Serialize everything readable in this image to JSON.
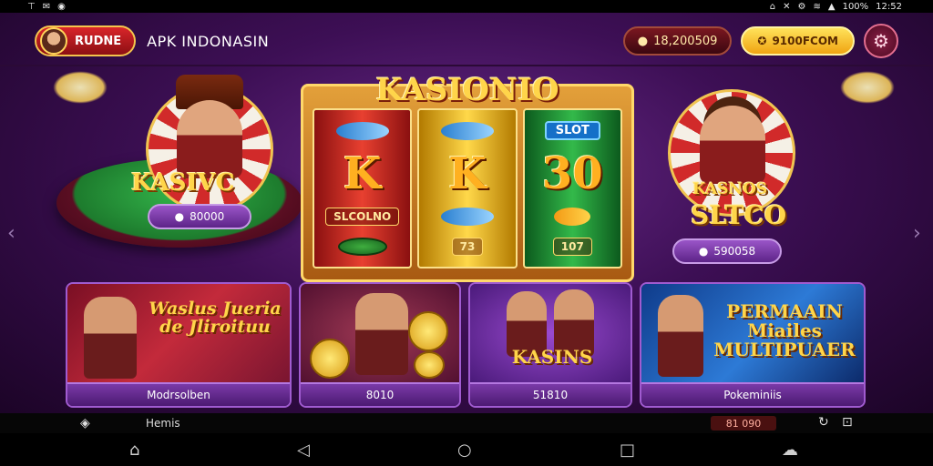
{
  "status_bar": {
    "left_icons": [
      "⊤",
      "✉",
      "◉"
    ],
    "right_icons": [
      "⌂",
      "✕",
      "⚙",
      "≋",
      "▲"
    ],
    "battery": "100%",
    "time": "12:52"
  },
  "header": {
    "brand": "RUDNE",
    "title": "APK INDONASIN",
    "balance_icon": "coin-icon",
    "balance": "18,200509",
    "deposit_label": "9100FCOM",
    "settings_icon": "gear-icon"
  },
  "hero": {
    "slot_title": "KASIONIO",
    "reels": [
      {
        "top": "fish",
        "main": "K",
        "bottom": "SLCOLNO",
        "foot": "chip"
      },
      {
        "top": "fish",
        "main": "K",
        "bottom": "fish",
        "foot": "73"
      },
      {
        "top": "SLOT",
        "main": "30",
        "bottom": "leaf",
        "foot": "107"
      }
    ],
    "left_logo": "KASIVC",
    "left_amount": "80000",
    "right_logo_1": "KASNOS",
    "right_logo_2": "SLTCO",
    "right_amount": "590058"
  },
  "cards": [
    {
      "art_text": "Waslus Jueria de Jliroituu",
      "label": "Modrsolben"
    },
    {
      "art_text": "",
      "label": "8010"
    },
    {
      "art_text": "KASINS",
      "label": "51810"
    },
    {
      "art_text": "PERMAAIN Miailes MULTIPUAER",
      "label": "Pokeminiis"
    }
  ],
  "bottom_bar": {
    "home_label": "Hemis",
    "badge": "81 090"
  },
  "nav": {
    "home": "⌂",
    "back": "◁",
    "circle": "○",
    "square": "□",
    "extra": "☁"
  },
  "colors": {
    "background": "#3d0f55",
    "accent_gold": "#ffd54a",
    "brand_red": "#d9252a",
    "card_border": "#a05bd0"
  }
}
